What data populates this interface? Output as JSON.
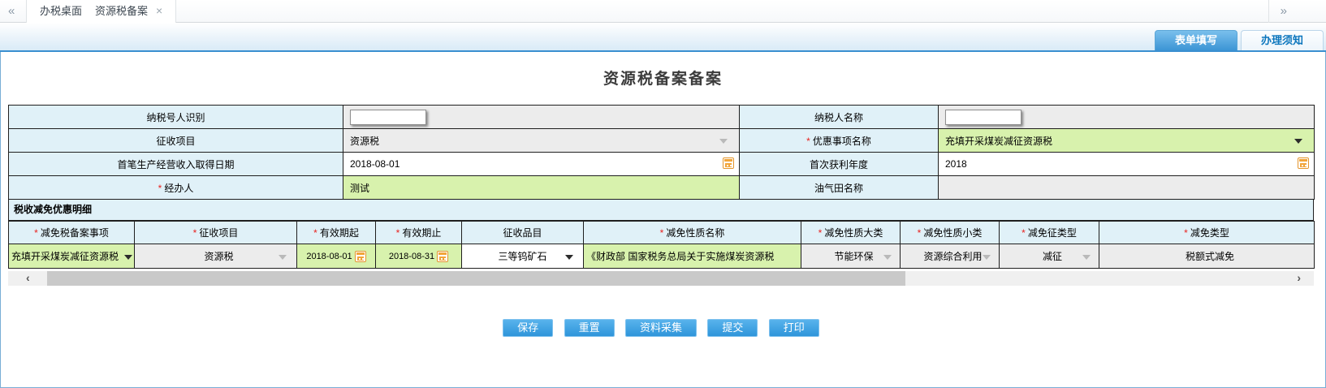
{
  "colors": {
    "accent": "#3a8fd0",
    "green_field": "#d8f2ad",
    "label_blue": "#e0f1f8",
    "disabled_gray": "#ececec",
    "calendar_orange": "#f2a53a",
    "required_red": "#e8221f",
    "button_blue": "#2f95da"
  },
  "tab_bar": {
    "left_chevron": "«",
    "right_chevron": "»",
    "tabs": [
      {
        "label": "办税桌面"
      },
      {
        "label": "资源税备案",
        "close": "×"
      }
    ]
  },
  "view_tabs": [
    {
      "label": "表单填写"
    },
    {
      "label": "办理须知"
    }
  ],
  "title": "资源税备案备案",
  "required_mark": "*",
  "form": {
    "taxpayer_id": {
      "label": "纳税号人识别",
      "value": ""
    },
    "taxpayer_name": {
      "label": "纳税人名称",
      "value": ""
    },
    "levy_project": {
      "label": "征收项目",
      "value": "资源税"
    },
    "preference_item": {
      "label": "优惠事项名称",
      "value": "充填开采煤炭减征资源税",
      "required": true
    },
    "first_income_date": {
      "label": "首笔生产经营收入取得日期",
      "value": "2018-08-01"
    },
    "first_profit_year": {
      "label": "首次获利年度",
      "value": "2018"
    },
    "handler": {
      "label": "经办人",
      "value": "测试",
      "required": true
    },
    "oilfield_name": {
      "label": "油气田名称",
      "value": ""
    }
  },
  "detail": {
    "section_title": "税收减免优惠明细",
    "columns": [
      {
        "label": "减免税备案事项",
        "required": true
      },
      {
        "label": "征收项目",
        "required": true
      },
      {
        "label": "有效期起",
        "required": true
      },
      {
        "label": "有效期止",
        "required": true
      },
      {
        "label": "征收品目",
        "required": false
      },
      {
        "label": "减免性质名称",
        "required": true
      },
      {
        "label": "减免性质大类",
        "required": true
      },
      {
        "label": "减免性质小类",
        "required": true
      },
      {
        "label": "减免征类型",
        "required": true
      },
      {
        "label": "减免类型",
        "required": true
      }
    ],
    "row": {
      "item": "充填开采煤炭减征资源税",
      "project": "资源税",
      "valid_from": "2018-08-01",
      "valid_to": "2018-08-31",
      "category": "三等钨矿石",
      "nature_name": "《财政部 国家税务总局关于实施煤炭资源税",
      "nature_major": "节能环保",
      "nature_minor": "资源综合利用",
      "levy_type": "减征",
      "reduction_type": "税额式减免"
    }
  },
  "buttons": [
    "保存",
    "重置",
    "资料采集",
    "提交",
    "打印"
  ],
  "scrollbar": {
    "left_arrow": "‹",
    "right_arrow": "›"
  }
}
